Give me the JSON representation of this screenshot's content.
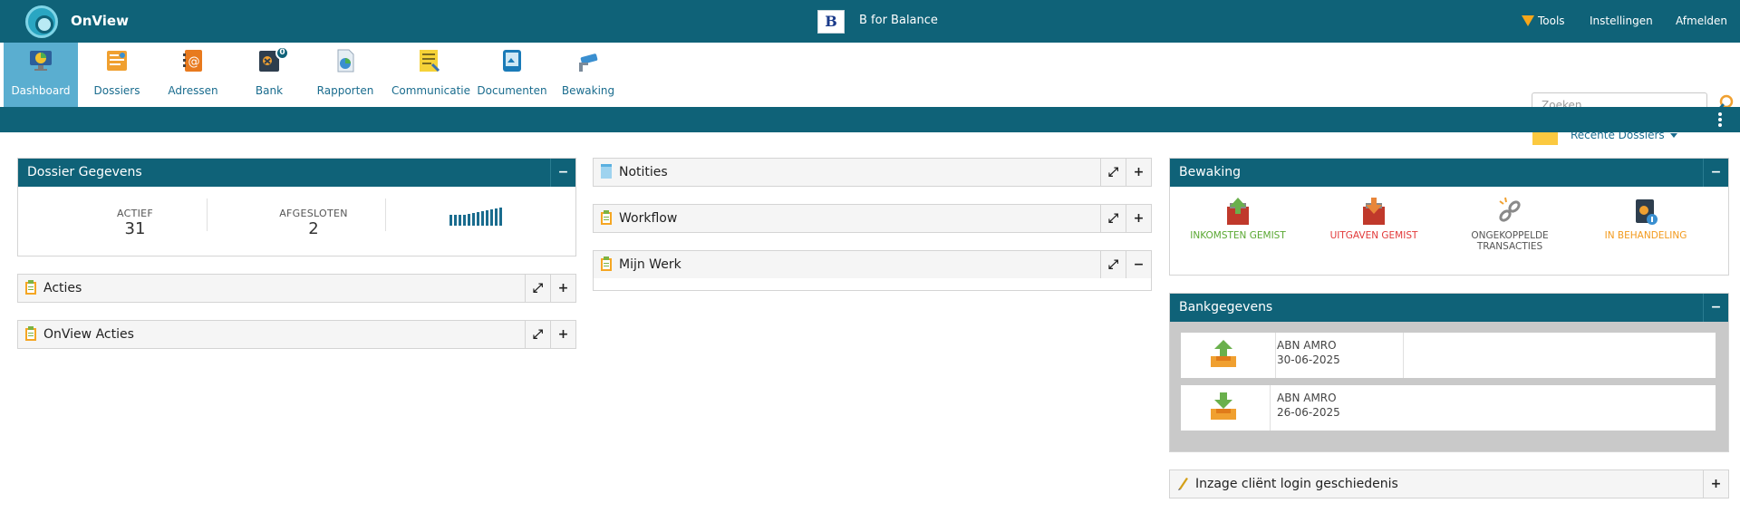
{
  "topbar": {
    "app_title": "OnView",
    "org_logo_text": "B",
    "org_name": "B for Balance",
    "tools": "Tools",
    "instellingen": "Instellingen",
    "afmelden": "Afmelden"
  },
  "nav": {
    "items": [
      {
        "label": "Dashboard",
        "icon": "dashboard-icon",
        "active": true
      },
      {
        "label": "Dossiers",
        "icon": "dossiers-icon"
      },
      {
        "label": "Adressen",
        "icon": "address-book-icon"
      },
      {
        "label": "Bank",
        "icon": "bank-icon",
        "badge": "0"
      },
      {
        "label": "Rapporten",
        "icon": "reports-icon"
      },
      {
        "label": "Communicatie",
        "icon": "communication-icon"
      },
      {
        "label": "Documenten",
        "icon": "documents-icon"
      },
      {
        "label": "Bewaking",
        "icon": "camera-icon"
      }
    ]
  },
  "search": {
    "placeholder": "Zoeken",
    "value": ""
  },
  "recent": {
    "label": "Recente Dossiers"
  },
  "dossier_gegevens": {
    "title": "Dossier Gegevens",
    "actief_label": "ACTIEF",
    "actief_value": "31",
    "afgesloten_label": "AFGESLOTEN",
    "afgesloten_value": "2"
  },
  "panels": {
    "acties": "Acties",
    "onview_acties": "OnView Acties",
    "notities": "Notities",
    "workflow": "Workflow",
    "mijn_werk": "Mijn Werk",
    "inzage": "Inzage cliënt login geschiedenis"
  },
  "bewaking": {
    "title": "Bewaking",
    "items": [
      {
        "label": "INKOMSTEN GEMIST",
        "color": "#5aa832"
      },
      {
        "label": "UITGAVEN GEMIST",
        "color": "#e23a3a"
      },
      {
        "label_line1": "ONGEKOPPELDE",
        "label_line2": "TRANSACTIES",
        "color": "#555555"
      },
      {
        "label": "IN BEHANDELING",
        "color": "#f39a1c"
      }
    ]
  },
  "bankgegevens": {
    "title": "Bankgegevens",
    "accounts": [
      {
        "bank": "ABN AMRO",
        "date": "30-06-2025",
        "direction": "up"
      },
      {
        "bank": "ABN AMRO",
        "date": "26-06-2025",
        "direction": "down"
      }
    ]
  },
  "colors": {
    "primary": "#0f6278",
    "accent": "#5aaed0",
    "tools_marker": "#f6a61a"
  }
}
